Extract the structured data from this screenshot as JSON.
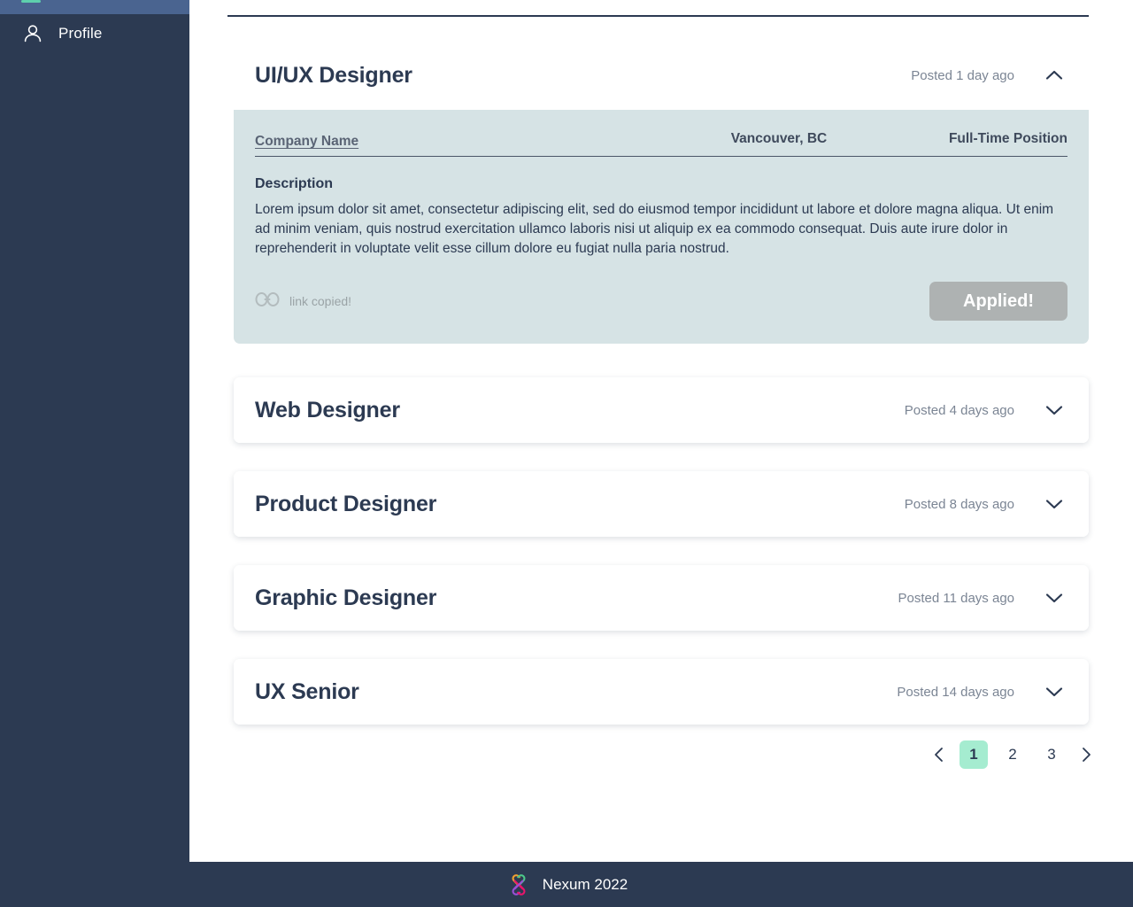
{
  "sidebar": {
    "items": [
      {
        "label": "",
        "icon": "active-item-indicator",
        "active": true
      },
      {
        "label": "Profile",
        "icon": "user-icon",
        "active": false
      }
    ]
  },
  "main": {
    "jobs": [
      {
        "title": "UI/UX Designer",
        "posted": "Posted 1 day ago",
        "expanded": true,
        "chevron": "chevron-up-icon",
        "detail": {
          "company": "Company Name",
          "location": "Vancouver, BC",
          "type": "Full-Time Position",
          "description_label": "Description",
          "description": "Lorem ipsum dolor sit amet, consectetur adipiscing elit, sed do eiusmod tempor incididunt ut labore et dolore magna aliqua. Ut enim ad minim veniam, quis nostrud exercitation ullamco laboris nisi ut aliquip ex ea commodo consequat. Duis aute irure dolor in reprehenderit in voluptate velit esse cillum dolore eu fugiat nulla paria nostrud.",
          "link_copied_label": "link copied!",
          "link_icon": "link-icon",
          "apply_button_label": "Applied!"
        }
      },
      {
        "title": "Web Designer",
        "posted": "Posted 4 days ago",
        "expanded": false,
        "chevron": "chevron-down-icon"
      },
      {
        "title": "Product Designer",
        "posted": "Posted 8 days ago",
        "expanded": false,
        "chevron": "chevron-down-icon"
      },
      {
        "title": "Graphic Designer",
        "posted": "Posted 11 days ago",
        "expanded": false,
        "chevron": "chevron-down-icon"
      },
      {
        "title": "UX Senior",
        "posted": "Posted 14 days ago",
        "expanded": false,
        "chevron": "chevron-down-icon"
      }
    ],
    "pagination": {
      "prev_icon": "chevron-left-icon",
      "next_icon": "chevron-right-icon",
      "pages": [
        "1",
        "2",
        "3"
      ],
      "current": "1"
    }
  },
  "footer": {
    "logo": "nexum-logo-icon",
    "text": "Nexum 2022"
  },
  "colors": {
    "sidebar_bg": "#2c3a52",
    "sidebar_active_bg": "#4a6490",
    "accent_teal": "#5ecfad",
    "detail_panel_bg": "#d6e3e5",
    "applied_button_bg": "#aeb2b2",
    "pagination_active_bg": "#a5ecd0",
    "title_text": "#2c3a52",
    "muted_text": "#7b8594",
    "logo_orange": "#f0a030",
    "logo_green": "#4cc98a",
    "logo_purple": "#9b4fd6",
    "logo_pink": "#e8156b"
  }
}
